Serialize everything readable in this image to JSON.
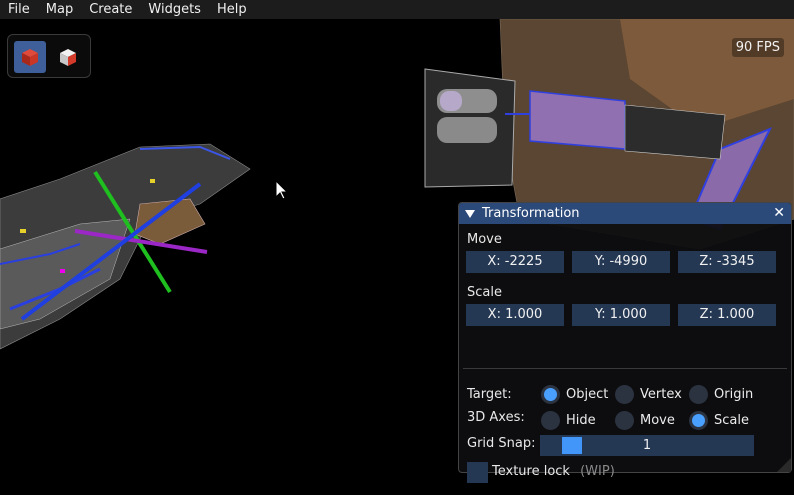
{
  "menu": [
    "File",
    "Map",
    "Create",
    "Widgets",
    "Help"
  ],
  "mode_toolbar": {
    "buttons": [
      {
        "icon": "red-cube-icon",
        "active": true
      },
      {
        "icon": "red-white-cube-icon",
        "active": false
      }
    ]
  },
  "fps": "90 FPS",
  "panel": {
    "title": "Transformation",
    "move": {
      "label": "Move",
      "x": "X: -2225",
      "y": "Y: -4990",
      "z": "Z: -3345"
    },
    "scale": {
      "label": "Scale",
      "x": "X: 1.000",
      "y": "Y: 1.000",
      "z": "Z: 1.000"
    },
    "target": {
      "label": "Target:",
      "options": [
        "Object",
        "Vertex",
        "Origin"
      ],
      "selected": "Object"
    },
    "axes": {
      "label": "3D Axes:",
      "options": [
        "Hide",
        "Move",
        "Scale"
      ],
      "selected": "Scale"
    },
    "grid_snap": {
      "label": "Grid Snap:",
      "value": "1"
    },
    "texture_lock": {
      "label": "Texture lock",
      "note": "(WIP)",
      "checked": false
    }
  },
  "colors": {
    "accent": "#4296fa",
    "title_bar": "#2b4a7a",
    "field_bg": "#243753",
    "gizmo_x": "#9b27c6",
    "gizmo_y": "#1fbf1f",
    "gizmo_z": "#1f3fe0"
  }
}
